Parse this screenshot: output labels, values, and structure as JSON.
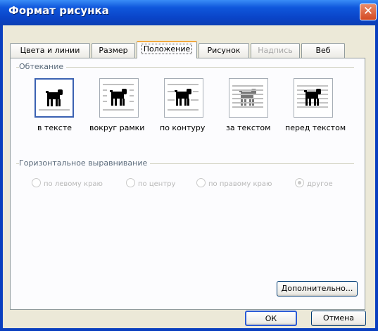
{
  "window": {
    "title": "Формат рисунка",
    "close_glyph": "✕"
  },
  "tabs": [
    {
      "label": "Цвета и линии",
      "state": "normal"
    },
    {
      "label": "Размер",
      "state": "normal"
    },
    {
      "label": "Положение",
      "state": "active"
    },
    {
      "label": "Рисунок",
      "state": "normal"
    },
    {
      "label": "Надпись",
      "state": "disabled"
    },
    {
      "label": "Веб",
      "state": "normal"
    }
  ],
  "wrapping": {
    "group_title": "Обтекание",
    "options": [
      {
        "label": "в тексте",
        "icon": "inline-with-text-icon",
        "selected": true
      },
      {
        "label": "вокруг рамки",
        "icon": "square-wrap-icon",
        "selected": false
      },
      {
        "label": "по контуру",
        "icon": "tight-wrap-icon",
        "selected": false
      },
      {
        "label": "за текстом",
        "icon": "behind-text-icon",
        "selected": false
      },
      {
        "label": "перед текстом",
        "icon": "in-front-of-text-icon",
        "selected": false
      }
    ]
  },
  "horizontal_alignment": {
    "group_title": "Горизонтальное выравнивание",
    "options": [
      {
        "label": "по левому краю",
        "checked": false
      },
      {
        "label": "по центру",
        "checked": false
      },
      {
        "label": "по правому краю",
        "checked": false
      },
      {
        "label": "другое",
        "checked": true
      }
    ]
  },
  "buttons": {
    "advanced": "Дополнительно...",
    "ok": "ОК",
    "cancel": "Отмена"
  },
  "colors": {
    "titlebar": "#0a44c8",
    "close": "#d44a22",
    "dialog": "#ece9d8",
    "selection": "#3b62b2"
  }
}
